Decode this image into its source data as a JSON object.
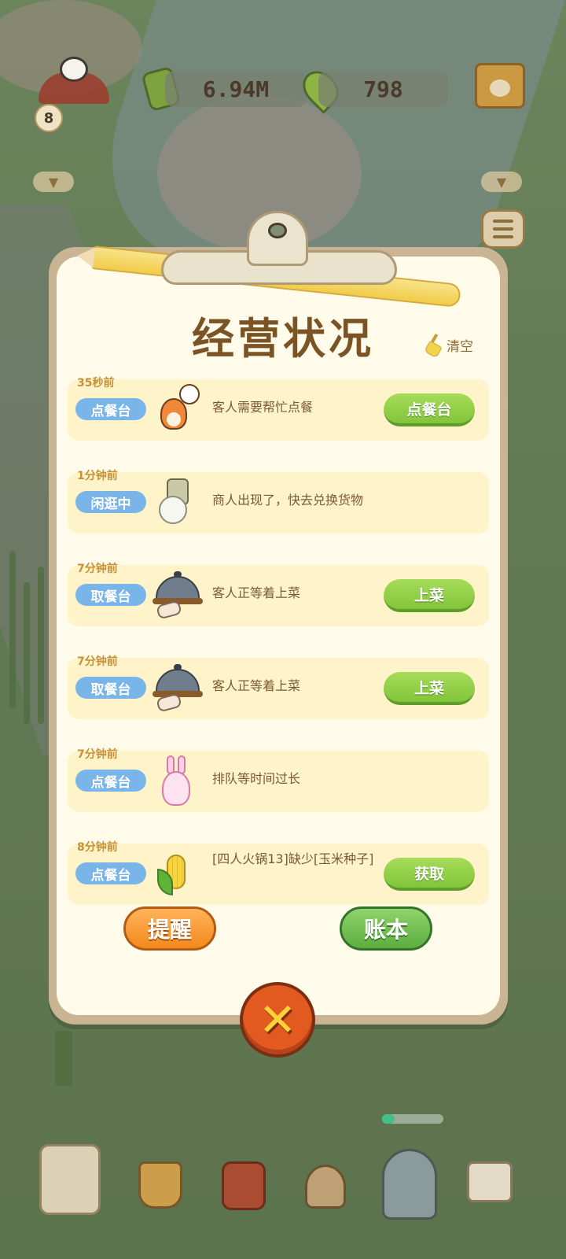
{
  "hud": {
    "bamboo_count": "6.94M",
    "leaf_count": "798",
    "level": "8"
  },
  "panel": {
    "title": "经营状况",
    "clear_label": "清空",
    "entries": [
      {
        "time": "35秒前",
        "tag": "点餐台",
        "avatar": "fox-icon",
        "message": "客人需要帮忙点餐",
        "action": "点餐台"
      },
      {
        "time": "1分钟前",
        "tag": "闲逛中",
        "avatar": "sheep-merchant-icon",
        "message": "商人出现了，快去兑换货物",
        "action": ""
      },
      {
        "time": "7分钟前",
        "tag": "取餐台",
        "avatar": "cloche-icon",
        "message": "客人正等着上菜",
        "action": "上菜"
      },
      {
        "time": "7分钟前",
        "tag": "取餐台",
        "avatar": "cloche-icon",
        "message": "客人正等着上菜",
        "action": "上菜"
      },
      {
        "time": "7分钟前",
        "tag": "点餐台",
        "avatar": "bunny-icon",
        "message": "排队等时间过长",
        "action": ""
      },
      {
        "time": "8分钟前",
        "tag": "点餐台",
        "avatar": "corn-icon",
        "message": "[四人火锅13]缺少[玉米种子]",
        "action": "获取"
      }
    ],
    "remind_label": "提醒",
    "ledger_label": "账本",
    "close_symbol": "✕"
  },
  "colors": {
    "accent_green": "#82c53a",
    "tag_blue": "#7ab5ea",
    "orange": "#f28a1d",
    "title_brown": "#7a5424"
  },
  "progress": {
    "fraction": 0.2
  }
}
